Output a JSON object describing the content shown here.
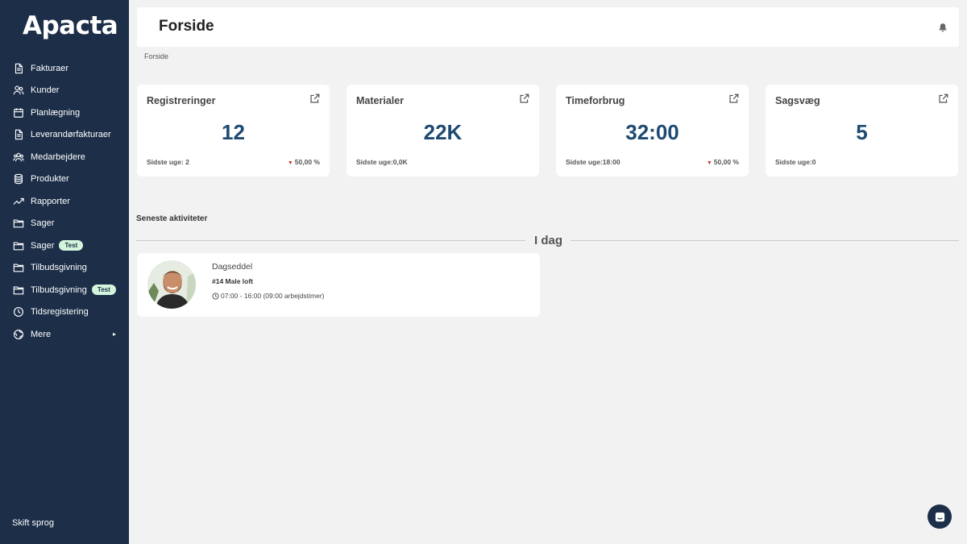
{
  "brand": {
    "name": "Apacta"
  },
  "sidebar": {
    "items": [
      {
        "label": "Fakturaer",
        "icon": "invoice-icon"
      },
      {
        "label": "Kunder",
        "icon": "customers-icon"
      },
      {
        "label": "Planlægning",
        "icon": "calendar-icon"
      },
      {
        "label": "Leverandørfakturaer",
        "icon": "supplier-invoice-icon"
      },
      {
        "label": "Medarbejdere",
        "icon": "employees-icon"
      },
      {
        "label": "Produkter",
        "icon": "database-icon"
      },
      {
        "label": "Rapporter",
        "icon": "trend-icon"
      },
      {
        "label": "Sager",
        "icon": "folder-icon"
      },
      {
        "label": "Sager",
        "icon": "folder-icon",
        "badge": "Test"
      },
      {
        "label": "Tilbudsgivning",
        "icon": "folder-icon"
      },
      {
        "label": "Tilbudsgivning",
        "icon": "folder-icon",
        "badge": "Test"
      },
      {
        "label": "Tidsregistering",
        "icon": "clock-icon"
      },
      {
        "label": "Mere",
        "icon": "more-icon",
        "arrow": "▸"
      }
    ],
    "language": "Skift sprog"
  },
  "header": {
    "title": "Forside",
    "icon": "bell-icon"
  },
  "breadcrumb": "Forside",
  "stats": [
    {
      "title": "Registreringer",
      "value": "12",
      "last_week": "Sidste uge: 2",
      "change": "50,00 %"
    },
    {
      "title": "Materialer",
      "value": "22K",
      "last_week": "Sidste uge:0,0K",
      "change": ""
    },
    {
      "title": "Timeforbrug",
      "value": "32:00",
      "last_week": "Sidste uge:18:00",
      "change": "50,00 %"
    },
    {
      "title": "Sagsvæg",
      "value": "5",
      "last_week": "Sidste uge:0",
      "change": ""
    }
  ],
  "activities": {
    "title": "Seneste aktiviteter",
    "day": "I dag",
    "items": [
      {
        "type": "Dagseddel",
        "name": "#14 Male loft",
        "time": "07:00 - 16:00 (09:00 arbejdstimer)"
      }
    ]
  },
  "colors": {
    "sidebar": "#1c2e48",
    "accent": "#1e4a72",
    "down": "#c0392b",
    "badge": "#d4f5dc"
  }
}
